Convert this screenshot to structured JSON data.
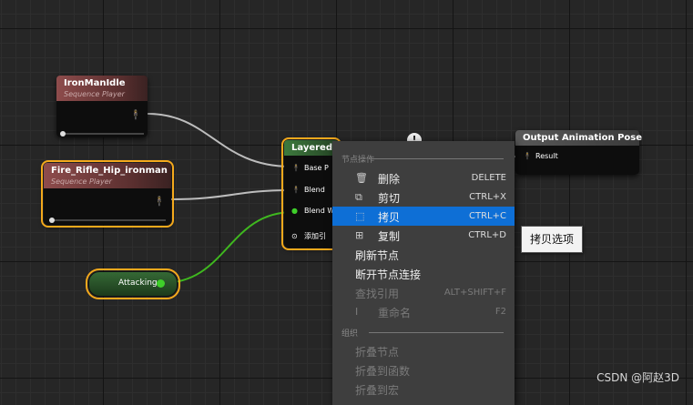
{
  "nodes": {
    "idle": {
      "title": "IronManIdle",
      "subtitle": "Sequence Player",
      "progress": 0.0
    },
    "rifle": {
      "title": "Fire_Rifle_Hip_ironman",
      "subtitle": "Sequence Player",
      "progress": 0.0
    },
    "layered": {
      "title": "Layered b",
      "pins": [
        "Base P",
        "Blend",
        "Blend W"
      ],
      "add_pin": "添加引"
    },
    "output": {
      "title": "Output Animation Pose",
      "pin": "Result"
    },
    "attacking": {
      "label": "Attacking"
    }
  },
  "menu": {
    "section_node_ops": "节点操作",
    "section_organize": "组织",
    "items": [
      {
        "label": "删除",
        "shortcut": "DELETE",
        "icon": "trash-icon",
        "enabled": true
      },
      {
        "label": "剪切",
        "shortcut": "CTRL+X",
        "icon": "cut-icon",
        "enabled": true
      },
      {
        "label": "拷贝",
        "shortcut": "CTRL+C",
        "icon": "copy-icon",
        "enabled": true,
        "highlighted": true
      },
      {
        "label": "复制",
        "shortcut": "CTRL+D",
        "icon": "duplicate-icon",
        "enabled": true
      },
      {
        "label": "刷新节点",
        "shortcut": "",
        "enabled": true
      },
      {
        "label": "断开节点连接",
        "shortcut": "",
        "enabled": true
      },
      {
        "label": "查找引用",
        "shortcut": "ALT+SHIFT+F",
        "enabled": false
      },
      {
        "label": "重命名",
        "shortcut": "F2",
        "icon": "rename-icon",
        "enabled": false
      },
      {
        "label": "折叠节点",
        "shortcut": "",
        "enabled": false
      },
      {
        "label": "折叠到函数",
        "shortcut": "",
        "enabled": false
      },
      {
        "label": "折叠到宏",
        "shortcut": "",
        "enabled": false
      }
    ]
  },
  "tooltip": "拷贝选项",
  "watermark": "CSDN @阿赵3D",
  "colors": {
    "selection": "#f4a91c",
    "highlight": "#0e6fd6",
    "bool_pin": "#3fcf2a",
    "pose_wire": "#c8c8c8",
    "bool_wire": "#3fb81f"
  }
}
